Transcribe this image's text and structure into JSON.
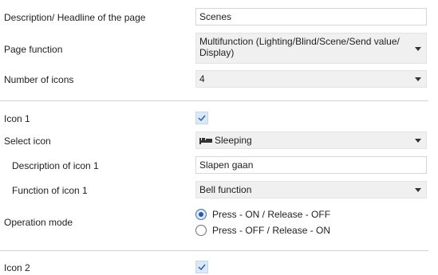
{
  "page_description": {
    "label": "Description/ Headline of the page",
    "value": "Scenes"
  },
  "page_function": {
    "label": "Page function",
    "value": "Multifunction (Lighting/Blind/Scene/Send value/ Display)"
  },
  "number_of_icons": {
    "label": "Number of icons",
    "value": "4"
  },
  "icon1": {
    "label": "Icon 1",
    "checked": true,
    "select_icon": {
      "label": "Select icon",
      "value": "Sleeping",
      "icon": "bed-icon"
    },
    "description": {
      "label": "Description of icon 1",
      "value": "Slapen gaan"
    },
    "function": {
      "label": "Function of icon 1",
      "value": "Bell function"
    },
    "operation_mode": {
      "label": "Operation mode",
      "options": [
        "Press - ON / Release - OFF",
        "Press - OFF / Release - ON"
      ],
      "selected": 0
    }
  },
  "icon2": {
    "label": "Icon 2",
    "checked": true
  }
}
